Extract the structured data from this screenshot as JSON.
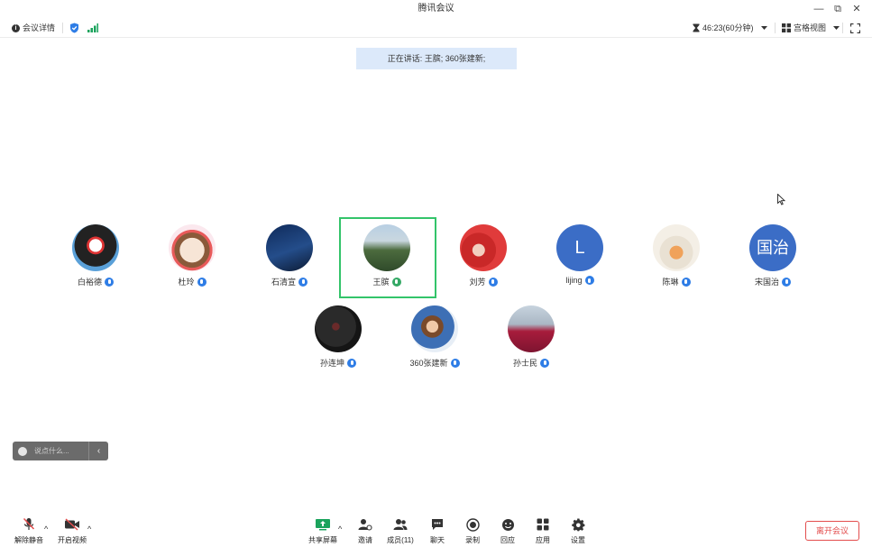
{
  "window": {
    "title": "腾讯会议",
    "controls": {
      "minimize": "—",
      "restore": "⧉",
      "close": "✕"
    }
  },
  "toolbar": {
    "meeting_details": "会议详情",
    "timer": "46:23(60分钟)",
    "view_mode": "宫格视图"
  },
  "speaking_banner": "正在讲话: 王膑; 360张建新;",
  "participants": [
    {
      "name": "白裕德"
    },
    {
      "name": "杜玲"
    },
    {
      "name": "石清宣"
    },
    {
      "name": "王膑"
    },
    {
      "name": "刘芳"
    },
    {
      "name": "lijing",
      "initial": "L"
    },
    {
      "name": "陈琳"
    },
    {
      "name": "宋国治",
      "initial": "国治"
    },
    {
      "name": "孙连坤"
    },
    {
      "name": "360张建新"
    },
    {
      "name": "孙士民"
    }
  ],
  "chat": {
    "placeholder": "说点什么...",
    "collapse": "‹"
  },
  "bottom_bar": {
    "unmute": "解除静音",
    "start_video": "开启视频",
    "share_screen": "共享屏幕",
    "invite": "邀请",
    "members": "成员(11)",
    "chat": "聊天",
    "record": "录制",
    "reactions": "回应",
    "apps": "应用",
    "settings": "设置",
    "leave": "离开会议"
  },
  "colors": {
    "accent": "#2e7de6",
    "speaking_bg": "#dce9fa",
    "active_border": "#33c46a",
    "leave_red": "#e34d4d",
    "share_green": "#1aa35c"
  }
}
